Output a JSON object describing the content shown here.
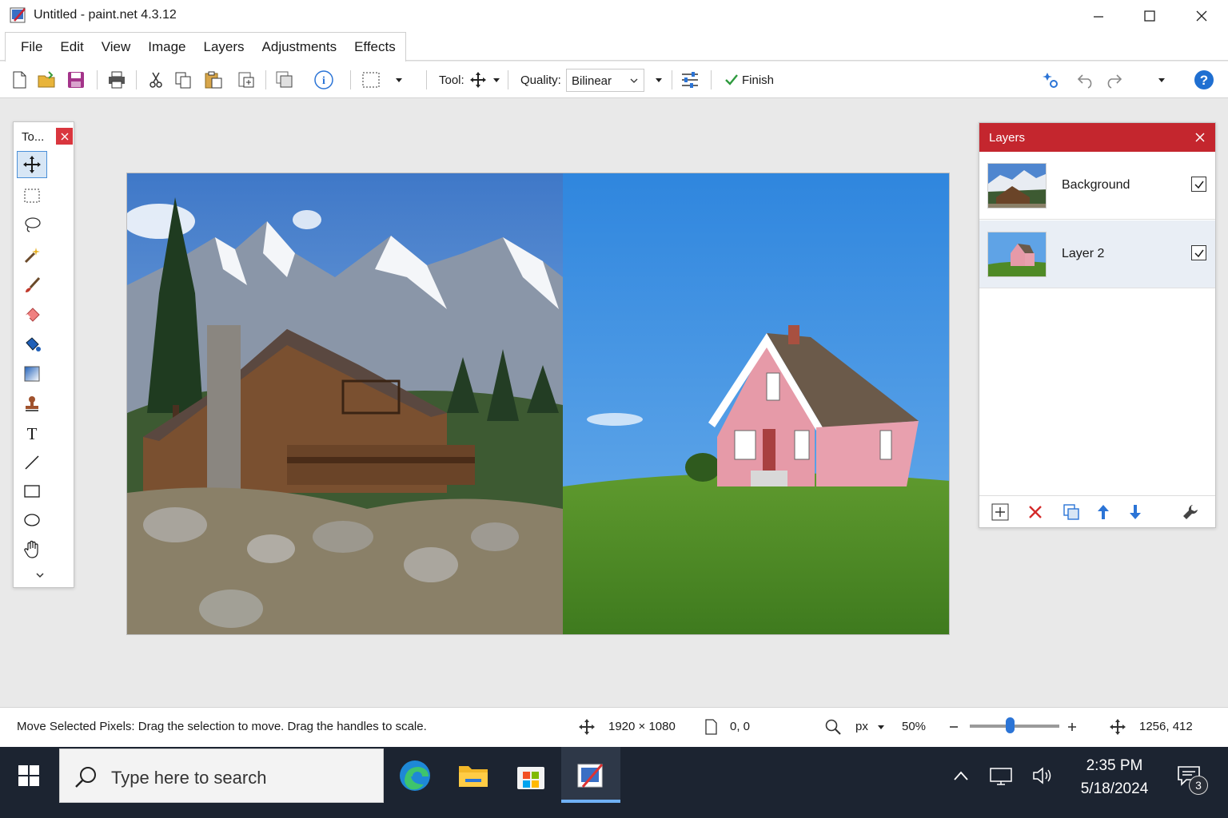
{
  "window": {
    "title": "Untitled - paint.net 4.3.12"
  },
  "menu": {
    "items": [
      "File",
      "Edit",
      "View",
      "Image",
      "Layers",
      "Adjustments",
      "Effects"
    ]
  },
  "toolbar": {
    "tool_label": "Tool:",
    "quality_label": "Quality:",
    "quality_value": "Bilinear",
    "finish_label": "Finish"
  },
  "tools_window": {
    "title": "To...",
    "tools": [
      "move-selected-pixels",
      "rectangle-select",
      "lasso-select",
      "magic-wand",
      "paintbrush",
      "eraser",
      "paint-bucket",
      "gradient",
      "clone-stamp",
      "text",
      "line",
      "rectangle",
      "ellipse",
      "pan"
    ],
    "active_tool": "move-selected-pixels"
  },
  "layers_window": {
    "title": "Layers",
    "layers": [
      {
        "name": "Background",
        "visible": true,
        "selected": false
      },
      {
        "name": "Layer 2",
        "visible": true,
        "selected": true
      }
    ]
  },
  "status": {
    "hint": "Move  Selected Pixels: Drag the selection to move. Drag the handles to scale.",
    "image_size": "1920 × 1080",
    "selection_offset": "0, 0",
    "unit": "px",
    "zoom": "50%",
    "zoom_fraction": 0.45,
    "cursor_position": "1256, 412"
  },
  "taskbar": {
    "search_placeholder": "Type here to search",
    "time": "2:35 PM",
    "date": "5/18/2024",
    "notification_count": "3"
  },
  "colors": {
    "accent_red": "#c4262e",
    "accent_blue": "#2b74d6",
    "taskbar": "#1c2431"
  }
}
